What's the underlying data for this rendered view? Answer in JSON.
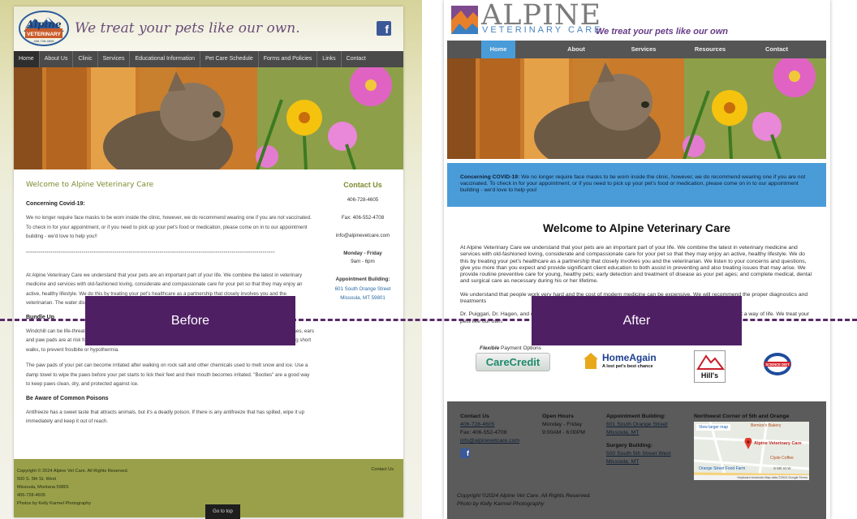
{
  "labels": {
    "before": "Before",
    "after": "After"
  },
  "before": {
    "logo_brand": "Alpine",
    "logo_sub": "VETERINARY",
    "logo_phone": "406-728-4605",
    "tagline": "We treat your pets like our own.",
    "fb_icon": "f",
    "nav": [
      "Home",
      "About Us",
      "Clinic",
      "Services",
      "Educational Information",
      "Pet Care Schedule",
      "Forms and Policies",
      "Links",
      "Contact"
    ],
    "heading": "Welcome to Alpine Veterinary Care",
    "covid_title": "Concerning Covid-19:",
    "covid_text": "We no longer require face masks to be worn inside the clinic, however, we do recommend wearing one if you are not vaccinated. To check in for your appointment, or if you need to pick up your pet's food or medication, please come on in to our appointment building - we'd love to help you!!",
    "stars": "*************************************************************************************************************************",
    "intro_text": "At Alpine Veterinary Care we understand that your pets are an important part of your life. We combine the latest in veterinary medicine and services with old-fashioned loving, considerate and compassionate care for your pet so that they may enjoy an active, healthy lifestyle. We do this by treating your pet's healthcare as a partnership that closely involves you and the veterinarian. The water dish should not be used by pets in winter and should be made of plastic instead of metal.",
    "bundle_title": "Bundle Up",
    "bundle_text": "Windchill can be life-threatening to your pet, no matter what the temperature.  During cold snaps, any exposed skin on noses, ears and paw pads are at risk for frostbite and hypothermia.  Short-haired dogs may benefit from wearing a sweater, even during short walks, to prevent frostbite or hypothermia.",
    "paws_text": "The paw pads of your pet can become irritated after walking on rock salt and other chemicals used to melt snow and ice.  Use a damp towel to wipe the paws before your pet starts to lick their feet and their mouth becomes irritated.  \"Booties\" are a good way to keep paws clean, dry, and protected against ice.",
    "common_title": "Be Aware of Common Poisons",
    "common_text": "Antifreeze has a sweet taste that attracts animals, but it's a deadly poison.  If there is any antifreeze that has spilled, wipe it up immediately and keep it out of reach.",
    "sidebar": {
      "title": "Contact Us",
      "phone": "406-728-4605",
      "fax": "Fax: 406-552-4708",
      "email": "info@alpinevetcare.com",
      "hours_day": "Monday - Friday",
      "hours_time": "9am - 6pm",
      "appt_title": "Appointment Building:",
      "appt_addr1": "601 South Orange Street",
      "appt_addr2": "Missoula, MT 59801"
    },
    "footer": {
      "copyright": "Copyright © 2024 Alpine Vet Care. All Rights Reserved.",
      "addr1": "500 S. 5th St. West",
      "addr2": "Missoula, Montana 59801",
      "phone": "406-728-4605",
      "photos": "Photos by Kelly Karmel Photography",
      "contact_link": "Contact Us"
    },
    "go_top": "Go to top"
  },
  "after": {
    "brand": "ALPINE",
    "brand_sub": "VETERINARY CARE",
    "tagline": "We treat your pets like our own",
    "nav": [
      "Home",
      "About",
      "Services",
      "Resources",
      "Contact"
    ],
    "covid_title": "Concerning COVID-19:",
    "covid_text": " We no longer require face masks to be worn inside the clinic, however, we do recommend wearing one if you are not vaccinated. To check in for your appointment, or if you need to pick up your pet's food or medication, please come on in to our appointment building - we'd love to help you!",
    "heading": "Welcome to Alpine Veterinary Care",
    "intro_text": "At Alpine Veterinary Care we understand that your pets are an important part of your life. We combine the latest in veterinary medicine and services with old-fashioned loving, considerate and compassionate care for your pet so that they may enjoy an active, healthy lifestyle. We do this by treating your pet's healthcare as a partnership that closely involves you and the veterinarian. We listen to your concerns and questions, give you more than you expect and provide significant client education to both assist in preventing and also treating issues that may arise. We provide routine preventive care for young, healthy pets; early detection and treatment of disease as your pet ages; and complete medical, dental and surgical care as necessary during his or her lifetime.",
    "cost_text": "We understand that people work very hard and the cost of modern medicine can be expensive. We will recommend the proper diagnostics and treatments",
    "doctors_text": "Dr. Puiggari, Dr. Hagen, and our staff believe that providing excellent veterinary care for your pet is not just a job but a way of life. We treat your pets like our own.",
    "partners": {
      "flex_prefix": "Flexible",
      "flex_label": "Payment Options",
      "carecredit": "CareCredit",
      "homeagain": "HomeAgain",
      "homeagain_sub": "A lost pet's best chance",
      "hills": "Hill's",
      "science_diet": "SCIENCE DIET"
    },
    "footer": {
      "contact_title": "Contact Us",
      "phone": "406-728-4605",
      "fax": "Fax: 406-552-4708",
      "email": "info@alpinevetcare.com",
      "hours_title": "Open Hours",
      "hours_day": "Monday - Friday",
      "hours_time": "9:00AM - 6:00PM",
      "appt_title": "Appointment Building:",
      "appt_addr1": "601 South Orange Street",
      "appt_addr2": "Missoula, MT",
      "surgery_title": "Surgery Building:",
      "surgery_addr1": "500 South 5th Street West",
      "surgery_addr2": "Missoula, MT",
      "map_title": "Northwest Corner of 5th and Orange",
      "map_larger": "View larger map",
      "map_bakery": "Bernice's Bakery",
      "map_pin": "Alpine Veterinary Care",
      "map_clyde": "Clyde Coffee",
      "map_street": "Orange Street Food Farm",
      "map_5th": "S 5th St W",
      "map_credits": "Keyboard shortcuts   Map data ©2024 Google   Terms",
      "copyright": "Copyright ©2024 Alpine Vet Care. All Rights Reserved.",
      "photos": "Photo by Kelly Karmel Photography"
    }
  }
}
